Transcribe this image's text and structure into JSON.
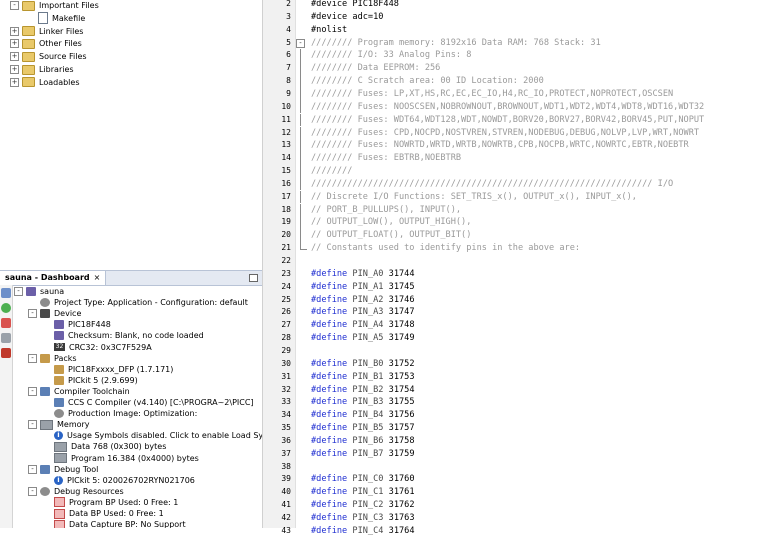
{
  "project_tree": {
    "items": [
      {
        "label": "Important Files",
        "indent": 1,
        "expander": "-",
        "icon": "folder"
      },
      {
        "label": "Makefile",
        "indent": 2,
        "expander": "",
        "icon": "file"
      },
      {
        "label": "Linker Files",
        "indent": 1,
        "expander": "+",
        "icon": "folder"
      },
      {
        "label": "Other Files",
        "indent": 1,
        "expander": "+",
        "icon": "folder"
      },
      {
        "label": "Source Files",
        "indent": 1,
        "expander": "+",
        "icon": "folder"
      },
      {
        "label": "Libraries",
        "indent": 1,
        "expander": "+",
        "icon": "folder"
      },
      {
        "label": "Loadables",
        "indent": 1,
        "expander": "+",
        "icon": "folder"
      }
    ]
  },
  "dashboard": {
    "tab_label": "sauna - Dashboard",
    "close_glyph": "×",
    "items": [
      {
        "label": "sauna",
        "indent": 0,
        "expander": "-",
        "icon": "chip"
      },
      {
        "label": "Project Type: Application - Configuration: default",
        "indent": 1,
        "expander": "",
        "icon": "gear"
      },
      {
        "label": "Device",
        "indent": 1,
        "expander": "-",
        "icon": "device"
      },
      {
        "label": "PIC18F448",
        "indent": 2,
        "expander": "",
        "icon": "chip"
      },
      {
        "label": "Checksum: Blank, no code loaded",
        "indent": 2,
        "expander": "",
        "icon": "chip"
      },
      {
        "label": "CRC32: 0x3C7F529A",
        "indent": 2,
        "expander": "",
        "icon": "crc"
      },
      {
        "label": "Packs",
        "indent": 1,
        "expander": "-",
        "icon": "pack"
      },
      {
        "label": "PIC18Fxxxx_DFP (1.7.171)",
        "indent": 2,
        "expander": "",
        "icon": "pack"
      },
      {
        "label": "PICkit 5 (2.9.699)",
        "indent": 2,
        "expander": "",
        "icon": "pack"
      },
      {
        "label": "Compiler Toolchain",
        "indent": 1,
        "expander": "-",
        "icon": "tool"
      },
      {
        "label": "CCS C Compiler (v4.140) [C:\\PROGRA~2\\PICC]",
        "indent": 2,
        "expander": "",
        "icon": "tool"
      },
      {
        "label": "Production Image: Optimization:",
        "indent": 2,
        "expander": "",
        "icon": "gear"
      },
      {
        "label": "Memory",
        "indent": 1,
        "expander": "-",
        "icon": "mem"
      },
      {
        "label": "Usage Symbols disabled. Click to enable Load Symbols.",
        "indent": 2,
        "expander": "",
        "icon": "info"
      },
      {
        "label": "Data 768 (0x300) bytes",
        "indent": 2,
        "expander": "",
        "icon": "mem"
      },
      {
        "label": "Program 16.384 (0x4000) bytes",
        "indent": 2,
        "expander": "",
        "icon": "mem"
      },
      {
        "label": "Debug Tool",
        "indent": 1,
        "expander": "-",
        "icon": "tool"
      },
      {
        "label": "PICkit 5: 020026702RYN021706",
        "indent": 2,
        "expander": "",
        "icon": "info"
      },
      {
        "label": "Debug Resources",
        "indent": 1,
        "expander": "-",
        "icon": "gear"
      },
      {
        "label": "Program BP Used: 0  Free: 1",
        "indent": 2,
        "expander": "",
        "icon": "bp"
      },
      {
        "label": "Data BP Used: 0  Free: 1",
        "indent": 2,
        "expander": "",
        "icon": "bp"
      },
      {
        "label": "Data Capture BP: No Support",
        "indent": 2,
        "expander": "",
        "icon": "bp"
      }
    ]
  },
  "editor": {
    "lines": [
      {
        "n": "2",
        "t": "#device PIC18F448",
        "k": "plain",
        "f": ""
      },
      {
        "n": "3",
        "t": "#device adc=10",
        "k": "plain",
        "f": ""
      },
      {
        "n": "4",
        "t": "#nolist",
        "k": "plain",
        "f": ""
      },
      {
        "n": "5",
        "t": "//////// Program memory: 8192x16  Data RAM: 768  Stack: 31",
        "k": "cmt",
        "f": "open"
      },
      {
        "n": "6",
        "t": "//////// I/O: 33   Analog Pins: 8",
        "k": "cmt",
        "f": "line"
      },
      {
        "n": "7",
        "t": "//////// Data EEPROM: 256",
        "k": "cmt",
        "f": "line"
      },
      {
        "n": "8",
        "t": "//////// C Scratch area: 00   ID Location: 2000",
        "k": "cmt",
        "f": "line"
      },
      {
        "n": "9",
        "t": "//////// Fuses: LP,XT,HS,RC,EC,EC_IO,H4,RC_IO,PROTECT,NOPROTECT,OSCSEN",
        "k": "cmt",
        "f": "line"
      },
      {
        "n": "10",
        "t": "//////// Fuses: NOOSCSEN,NOBROWNOUT,BROWNOUT,WDT1,WDT2,WDT4,WDT8,WDT16,WDT32",
        "k": "cmt",
        "f": "line"
      },
      {
        "n": "11",
        "t": "//////// Fuses: WDT64,WDT128,WDT,NOWDT,BORV20,BORV27,BORV42,BORV45,PUT,NOPUT",
        "k": "cmt",
        "f": "line"
      },
      {
        "n": "12",
        "t": "//////// Fuses: CPD,NOCPD,NOSTVREN,STVREN,NODEBUG,DEBUG,NOLVP,LVP,WRT,NOWRT",
        "k": "cmt",
        "f": "line"
      },
      {
        "n": "13",
        "t": "//////// Fuses: NOWRTD,WRTD,WRTB,NOWRTB,CPB,NOCPB,WRTC,NOWRTC,EBTR,NOEBTR",
        "k": "cmt",
        "f": "line"
      },
      {
        "n": "14",
        "t": "//////// Fuses: EBTRB,NOEBTRB",
        "k": "cmt",
        "f": "line"
      },
      {
        "n": "15",
        "t": "////////",
        "k": "cmt",
        "f": "line"
      },
      {
        "n": "16",
        "t": "////////////////////////////////////////////////////////////////// I/O",
        "k": "cmt",
        "f": "line"
      },
      {
        "n": "17",
        "t": "// Discrete I/O Functions: SET_TRIS_x(), OUTPUT_x(), INPUT_x(),",
        "k": "cmt",
        "f": "line"
      },
      {
        "n": "18",
        "t": "//                         PORT_B_PULLUPS(), INPUT(),",
        "k": "cmt",
        "f": "line"
      },
      {
        "n": "19",
        "t": "//                         OUTPUT_LOW(), OUTPUT_HIGH(),",
        "k": "cmt",
        "f": "line"
      },
      {
        "n": "20",
        "t": "//                         OUTPUT_FLOAT(), OUTPUT_BIT()",
        "k": "cmt",
        "f": "line"
      },
      {
        "n": "21",
        "t": "// Constants used to identify pins in the above are:",
        "k": "cmt",
        "f": "end"
      },
      {
        "n": "22",
        "t": "",
        "k": "plain",
        "f": ""
      },
      {
        "n": "23",
        "t": "#define PIN_A0  31744",
        "k": "def",
        "f": ""
      },
      {
        "n": "24",
        "t": "#define PIN_A1  31745",
        "k": "def",
        "f": ""
      },
      {
        "n": "25",
        "t": "#define PIN_A2  31746",
        "k": "def",
        "f": ""
      },
      {
        "n": "26",
        "t": "#define PIN_A3  31747",
        "k": "def",
        "f": ""
      },
      {
        "n": "27",
        "t": "#define PIN_A4  31748",
        "k": "def",
        "f": ""
      },
      {
        "n": "28",
        "t": "#define PIN_A5  31749",
        "k": "def",
        "f": ""
      },
      {
        "n": "29",
        "t": "",
        "k": "plain",
        "f": ""
      },
      {
        "n": "30",
        "t": "#define PIN_B0  31752",
        "k": "def",
        "f": ""
      },
      {
        "n": "31",
        "t": "#define PIN_B1  31753",
        "k": "def",
        "f": ""
      },
      {
        "n": "32",
        "t": "#define PIN_B2  31754",
        "k": "def",
        "f": ""
      },
      {
        "n": "33",
        "t": "#define PIN_B3  31755",
        "k": "def",
        "f": ""
      },
      {
        "n": "34",
        "t": "#define PIN_B4  31756",
        "k": "def",
        "f": ""
      },
      {
        "n": "35",
        "t": "#define PIN_B5  31757",
        "k": "def",
        "f": ""
      },
      {
        "n": "36",
        "t": "#define PIN_B6  31758",
        "k": "def",
        "f": ""
      },
      {
        "n": "37",
        "t": "#define PIN_B7  31759",
        "k": "def",
        "f": ""
      },
      {
        "n": "38",
        "t": "",
        "k": "plain",
        "f": ""
      },
      {
        "n": "39",
        "t": "#define PIN_C0  31760",
        "k": "def",
        "f": ""
      },
      {
        "n": "40",
        "t": "#define PIN_C1  31761",
        "k": "def",
        "f": ""
      },
      {
        "n": "41",
        "t": "#define PIN_C2  31762",
        "k": "def",
        "f": ""
      },
      {
        "n": "42",
        "t": "#define PIN_C3  31763",
        "k": "def",
        "f": ""
      },
      {
        "n": "43",
        "t": "#define PIN_C4  31764",
        "k": "def",
        "f": ""
      }
    ]
  },
  "colors": {
    "comment": "#9a9a9a",
    "keyword": "#1f2ed1",
    "macro": "#4a4a4a",
    "folder": "#e9c96a",
    "header": "#e4e9f2"
  }
}
